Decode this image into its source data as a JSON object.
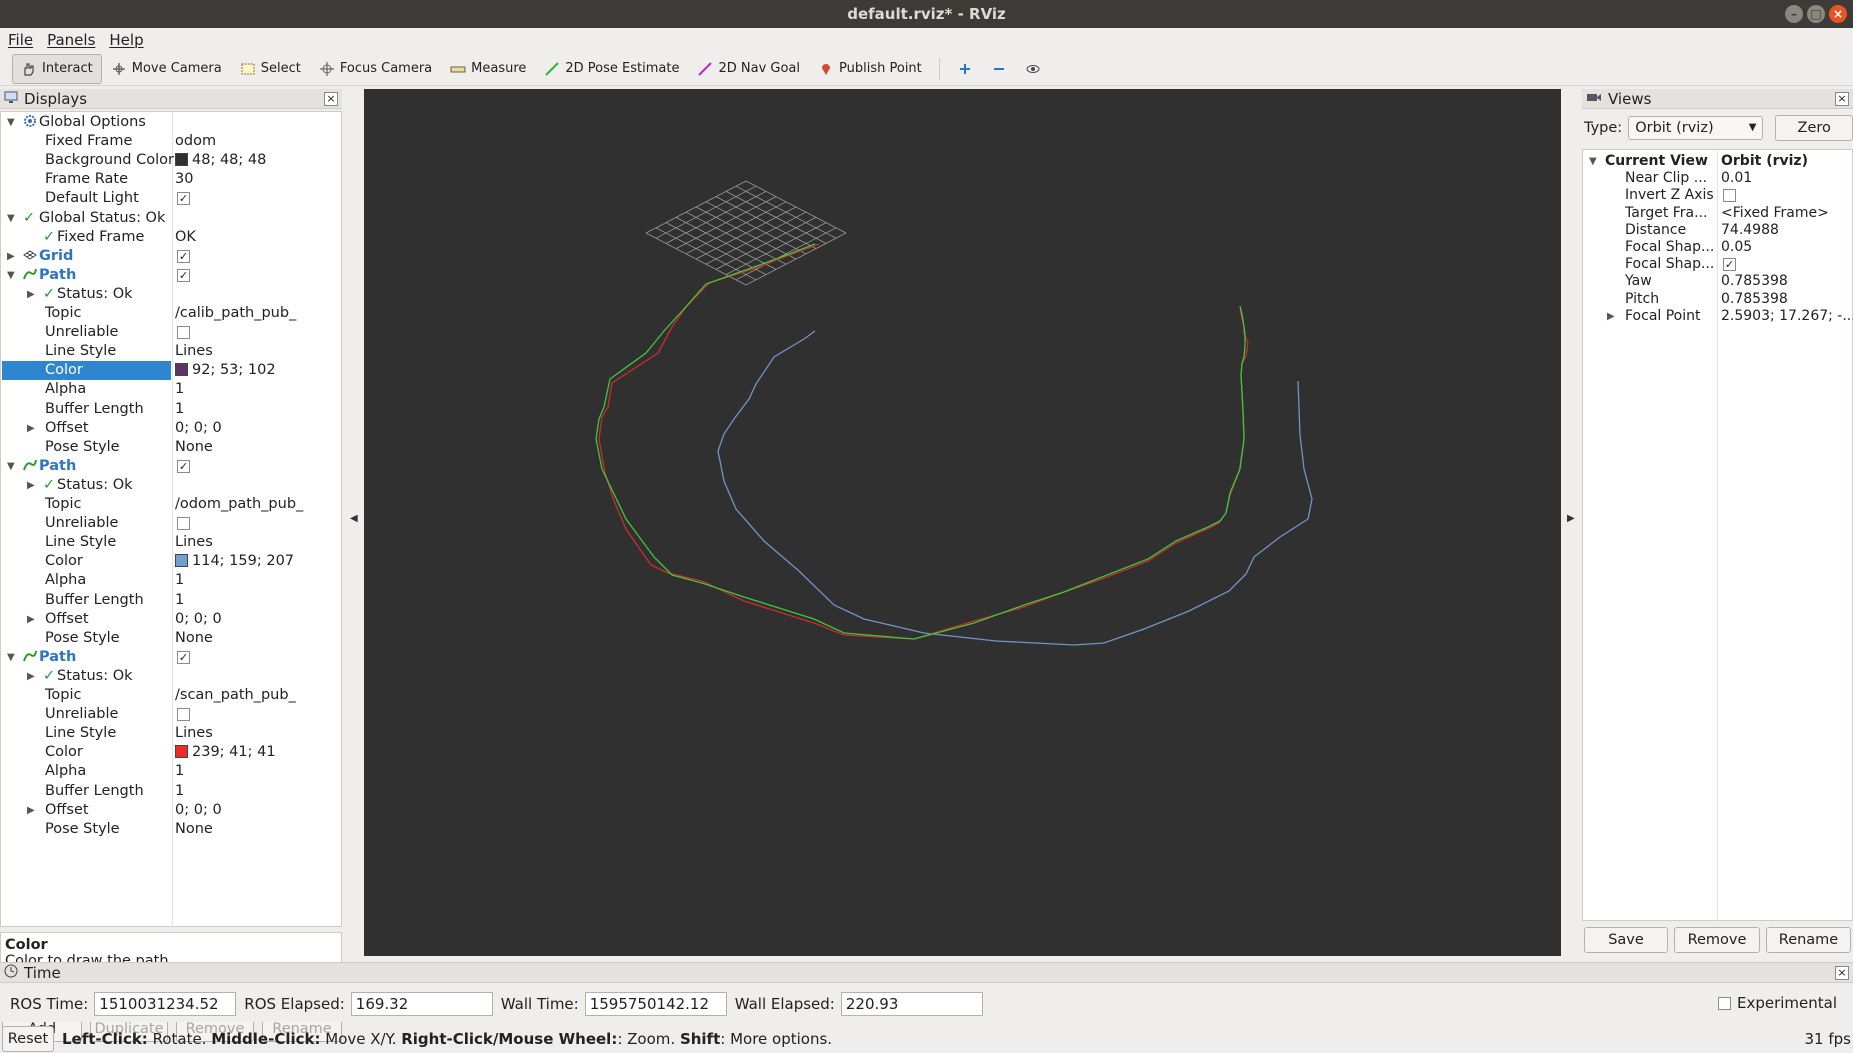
{
  "window": {
    "title": "default.rviz* - RViz"
  },
  "menu": [
    "File",
    "Panels",
    "Help"
  ],
  "toolbar": {
    "tools": [
      {
        "label": "Interact",
        "icon": "hand-icon",
        "active": true
      },
      {
        "label": "Move Camera",
        "icon": "move-camera-icon"
      },
      {
        "label": "Select",
        "icon": "select-icon"
      },
      {
        "label": "Focus Camera",
        "icon": "focus-camera-icon"
      },
      {
        "label": "Measure",
        "icon": "measure-icon"
      },
      {
        "label": "2D Pose Estimate",
        "icon": "pose-estimate-icon"
      },
      {
        "label": "2D Nav Goal",
        "icon": "nav-goal-icon"
      },
      {
        "label": "Publish Point",
        "icon": "publish-point-icon"
      }
    ]
  },
  "displays": {
    "title": "Displays",
    "rows": [
      {
        "name": "Global Options",
        "value": "",
        "level": 0,
        "expand": "open",
        "icon": "gear-icon"
      },
      {
        "name": "Fixed Frame",
        "value": "odom",
        "level": 1
      },
      {
        "name": "Background Color",
        "value": "48; 48; 48",
        "level": 1,
        "swatch": "#303030"
      },
      {
        "name": "Frame Rate",
        "value": "30",
        "level": 1
      },
      {
        "name": "Default Light",
        "value": "",
        "level": 1,
        "check": true
      },
      {
        "name": "Global Status: Ok",
        "value": "",
        "level": 0,
        "expand": "open",
        "icon": "ok-check-icon"
      },
      {
        "name": "Fixed Frame",
        "value": "OK",
        "level": 1,
        "icon": "ok-check-icon"
      },
      {
        "name": "Grid",
        "value": "",
        "level": 0,
        "expand": "closed",
        "icon": "grid-icon",
        "highlight": true,
        "check": true
      },
      {
        "name": "Path",
        "value": "",
        "level": 0,
        "expand": "open",
        "icon": "path-icon",
        "highlight": true,
        "check": true
      },
      {
        "name": "Status: Ok",
        "value": "",
        "level": 1,
        "expand": "closed",
        "icon": "ok-check-icon"
      },
      {
        "name": "Topic",
        "value": "/calib_path_pub_",
        "level": 1
      },
      {
        "name": "Unreliable",
        "value": "",
        "level": 1,
        "check": false
      },
      {
        "name": "Line Style",
        "value": "Lines",
        "level": 1
      },
      {
        "name": "Color",
        "value": "92; 53; 102",
        "level": 1,
        "swatch": "#5c3566",
        "selected": true
      },
      {
        "name": "Alpha",
        "value": "1",
        "level": 1
      },
      {
        "name": "Buffer Length",
        "value": "1",
        "level": 1
      },
      {
        "name": "Offset",
        "value": "0; 0; 0",
        "level": 1,
        "expand": "closed"
      },
      {
        "name": "Pose Style",
        "value": "None",
        "level": 1
      },
      {
        "name": "Path",
        "value": "",
        "level": 0,
        "expand": "open",
        "icon": "path-icon",
        "highlight": true,
        "check": true
      },
      {
        "name": "Status: Ok",
        "value": "",
        "level": 1,
        "expand": "closed",
        "icon": "ok-check-icon"
      },
      {
        "name": "Topic",
        "value": "/odom_path_pub_",
        "level": 1
      },
      {
        "name": "Unreliable",
        "value": "",
        "level": 1,
        "check": false
      },
      {
        "name": "Line Style",
        "value": "Lines",
        "level": 1
      },
      {
        "name": "Color",
        "value": "114; 159; 207",
        "level": 1,
        "swatch": "#729fcf"
      },
      {
        "name": "Alpha",
        "value": "1",
        "level": 1
      },
      {
        "name": "Buffer Length",
        "value": "1",
        "level": 1
      },
      {
        "name": "Offset",
        "value": "0; 0; 0",
        "level": 1,
        "expand": "closed"
      },
      {
        "name": "Pose Style",
        "value": "None",
        "level": 1
      },
      {
        "name": "Path",
        "value": "",
        "level": 0,
        "expand": "open",
        "icon": "path-icon",
        "highlight": true,
        "check": true
      },
      {
        "name": "Status: Ok",
        "value": "",
        "level": 1,
        "expand": "closed",
        "icon": "ok-check-icon"
      },
      {
        "name": "Topic",
        "value": "/scan_path_pub_",
        "level": 1
      },
      {
        "name": "Unreliable",
        "value": "",
        "level": 1,
        "check": false
      },
      {
        "name": "Line Style",
        "value": "Lines",
        "level": 1
      },
      {
        "name": "Color",
        "value": "239; 41; 41",
        "level": 1,
        "swatch": "#ef2929"
      },
      {
        "name": "Alpha",
        "value": "1",
        "level": 1
      },
      {
        "name": "Buffer Length",
        "value": "1",
        "level": 1
      },
      {
        "name": "Offset",
        "value": "0; 0; 0",
        "level": 1,
        "expand": "closed"
      },
      {
        "name": "Pose Style",
        "value": "None",
        "level": 1
      }
    ],
    "description_title": "Color",
    "description_text": "Color to draw the path.",
    "buttons": [
      "Add",
      "Duplicate",
      "Remove",
      "Rename"
    ]
  },
  "views": {
    "title": "Views",
    "type_label": "Type:",
    "type_value": "Orbit (rviz)",
    "zero_label": "Zero",
    "header": {
      "name": "Current View",
      "value": "Orbit (rviz)"
    },
    "rows": [
      {
        "name": "Near Clip ...",
        "value": "0.01"
      },
      {
        "name": "Invert Z Axis",
        "value": "",
        "check": false
      },
      {
        "name": "Target Fra...",
        "value": "<Fixed Frame>"
      },
      {
        "name": "Distance",
        "value": "74.4988"
      },
      {
        "name": "Focal Shap...",
        "value": "0.05"
      },
      {
        "name": "Focal Shap...",
        "value": "",
        "check": true
      },
      {
        "name": "Yaw",
        "value": "0.785398"
      },
      {
        "name": "Pitch",
        "value": "0.785398"
      },
      {
        "name": "Focal Point",
        "value": "2.5903; 17.267; -...",
        "expand": "closed"
      }
    ],
    "buttons": [
      "Save",
      "Remove",
      "Rename"
    ]
  },
  "time": {
    "title": "Time",
    "ros_time_label": "ROS Time:",
    "ros_time": "1510031234.52",
    "ros_elapsed_label": "ROS Elapsed:",
    "ros_elapsed": "169.32",
    "wall_time_label": "Wall Time:",
    "wall_time": "1595750142.12",
    "wall_elapsed_label": "Wall Elapsed:",
    "wall_elapsed": "220.93",
    "experimental_label": "Experimental"
  },
  "status": {
    "reset_label": "Reset",
    "parts": [
      {
        "b": "Left-Click:",
        "t": " Rotate. "
      },
      {
        "b": "Middle-Click:",
        "t": " Move X/Y. "
      },
      {
        "b": "Right-Click/Mouse Wheel:",
        "t": ": Zoom. "
      },
      {
        "b": "Shift",
        "t": ": More options."
      }
    ],
    "fps": "31 fps"
  },
  "scene": {
    "background": "#303030",
    "path_colors": {
      "green": "#3cc83c",
      "red": "#d12a2a",
      "blue": "#6f94c8"
    }
  }
}
